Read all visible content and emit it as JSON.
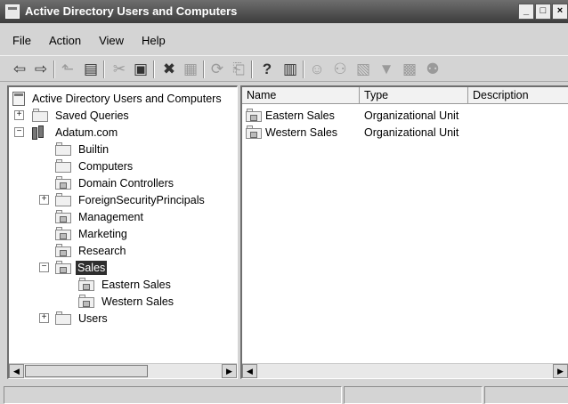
{
  "window": {
    "title": "Active Directory Users and Computers",
    "controls": {
      "minimize": "_",
      "maximize": "□",
      "close": "×"
    }
  },
  "menu": [
    "File",
    "Action",
    "View",
    "Help"
  ],
  "toolbar_icons": [
    "back-arrow-icon",
    "forward-arrow-icon",
    "up-folder-icon",
    "show-console-tree-icon",
    "cut-icon",
    "copy-icon",
    "delete-icon",
    "properties-icon",
    "refresh-icon",
    "export-list-icon",
    "help-icon",
    "show-action-pane-icon",
    "add-user-icon",
    "add-group-icon",
    "add-ou-icon",
    "filter-icon",
    "find-icon",
    "add-to-group-icon"
  ],
  "tree": {
    "root": "Active Directory Users and Computers",
    "items": [
      {
        "label": "Saved Queries",
        "expander": "+"
      },
      {
        "label": "Adatum.com",
        "expander": "−"
      },
      {
        "label": "Builtin"
      },
      {
        "label": "Computers"
      },
      {
        "label": "Domain Controllers"
      },
      {
        "label": "ForeignSecurityPrincipals",
        "expander": "+"
      },
      {
        "label": "Management"
      },
      {
        "label": "Marketing"
      },
      {
        "label": "Research"
      },
      {
        "label": "Sales",
        "expander": "−",
        "selected": true
      },
      {
        "label": "Eastern Sales"
      },
      {
        "label": "Western Sales"
      },
      {
        "label": "Users",
        "expander": "+"
      }
    ]
  },
  "list": {
    "columns": [
      "Name",
      "Type",
      "Description"
    ],
    "rows": [
      {
        "name": "Eastern Sales",
        "type": "Organizational Unit",
        "description": ""
      },
      {
        "name": "Western Sales",
        "type": "Organizational Unit",
        "description": ""
      }
    ]
  },
  "scroll_arrows": {
    "left": "◀",
    "right": "▶"
  },
  "status": [
    "",
    "",
    ""
  ]
}
